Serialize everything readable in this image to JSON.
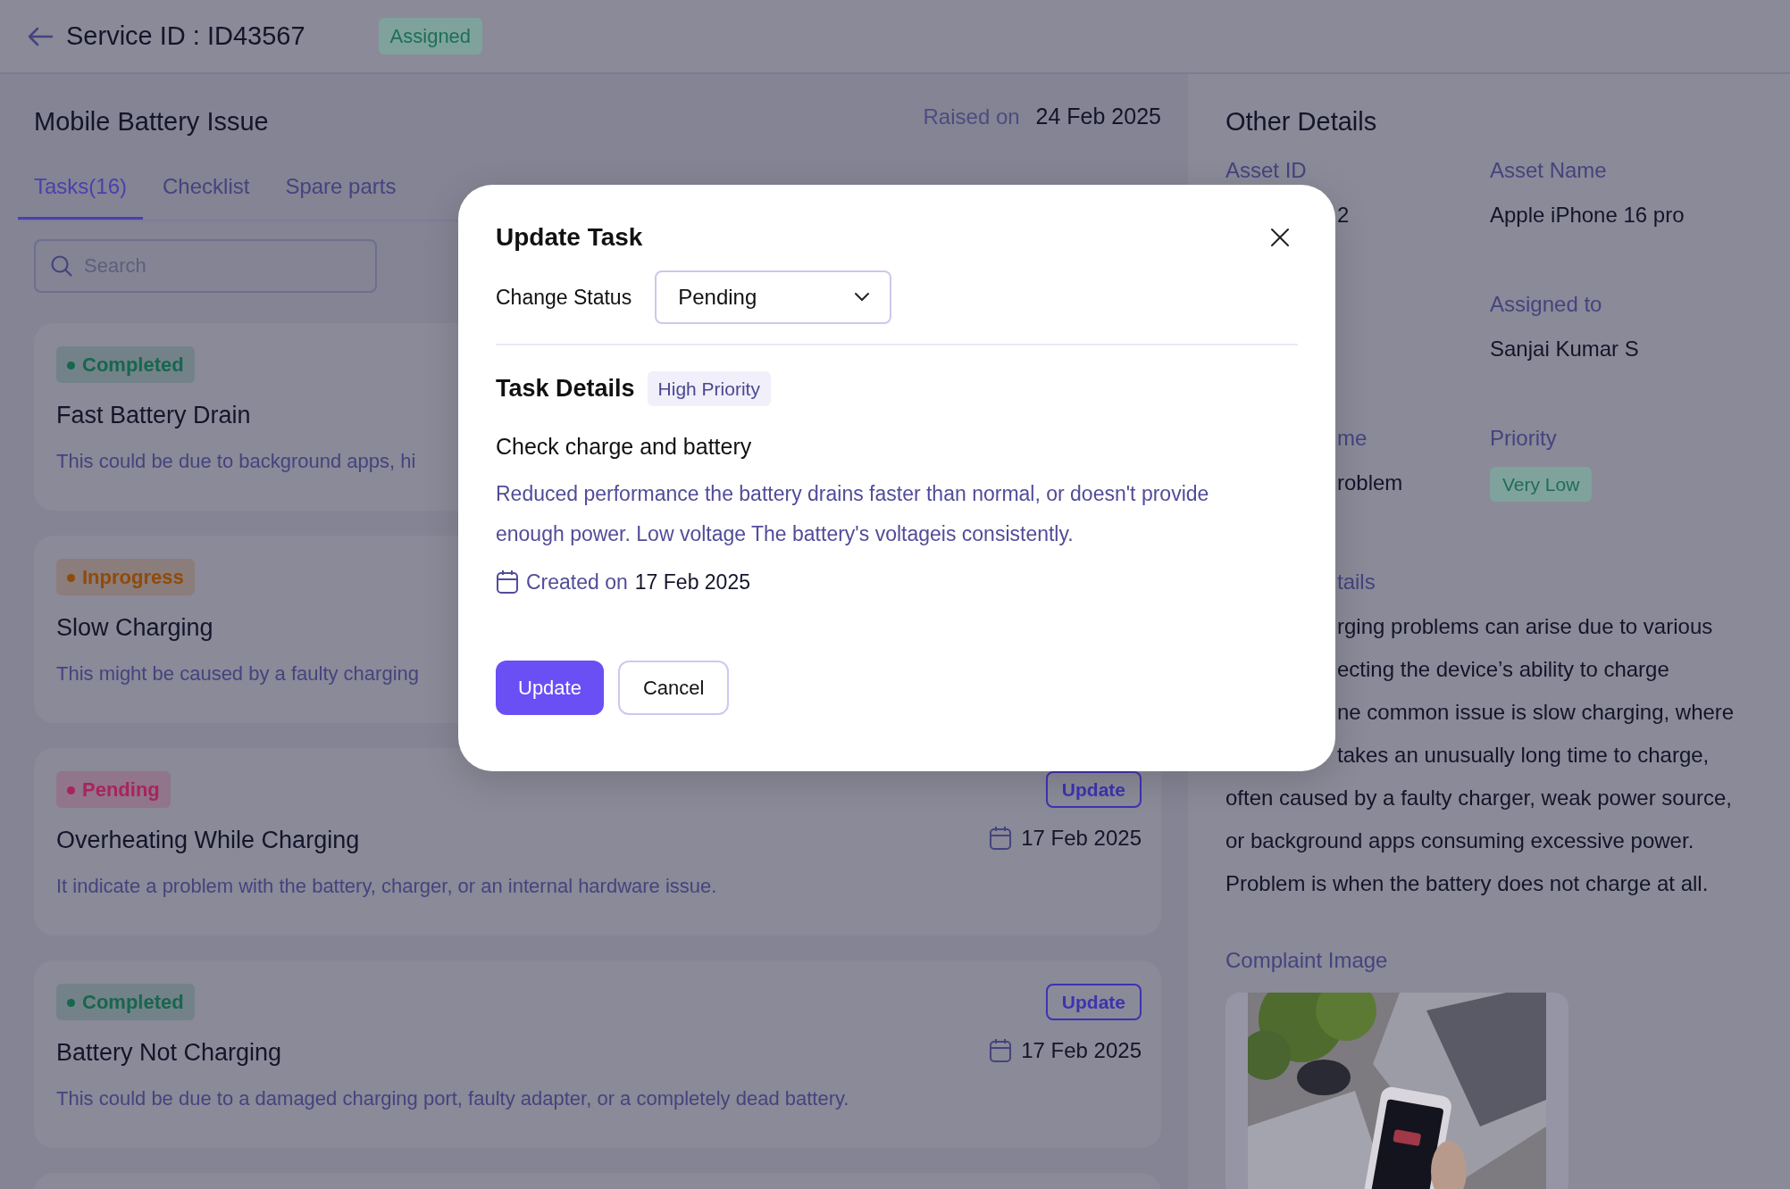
{
  "header": {
    "title": "Service ID : ID43567",
    "status": "Assigned"
  },
  "issue": {
    "title": "Mobile Battery Issue",
    "raised_label": "Raised on",
    "raised_date": "24 Feb 2025"
  },
  "tabs": [
    {
      "label": "Tasks(16)",
      "selected": true
    },
    {
      "label": "Checklist",
      "selected": false
    },
    {
      "label": "Spare parts",
      "selected": false
    }
  ],
  "search": {
    "placeholder": "Search"
  },
  "tasks": [
    {
      "status": "Completed",
      "color": "#17664e",
      "title": "Fast Battery Drain",
      "description": "This could be due to background apps, hi"
    },
    {
      "status": "Inprogress",
      "color": "#8f4a0c",
      "title": "Slow Charging",
      "description": "This might be caused by a faulty charging"
    },
    {
      "status": "Pending",
      "color": "#a8245c",
      "title": "Overheating While Charging",
      "description": "It indicate a problem with the battery, charger, or an internal hardware issue.",
      "action": "Update",
      "date": "17 Feb 2025"
    },
    {
      "status": "Completed",
      "color": "#17664e",
      "title": "Battery Not Charging",
      "description": "This could be due to a damaged charging port, faulty adapter, or a completely dead battery.",
      "action": "Update",
      "date": "17 Feb 2025"
    }
  ],
  "other_details": {
    "title": "Other Details",
    "rows": [
      {
        "left": {
          "label": {
            "text": "Asset ID"
          },
          "value": {
            "text": "2",
            "covered": true
          }
        },
        "right": {
          "label": {
            "text": "Asset Name"
          },
          "value": {
            "text": "Apple iPhone 16 pro",
            "kind": "text"
          }
        }
      },
      {
        "right": {
          "label": {
            "text": "Assigned to"
          },
          "value": {
            "text": "Sanjai Kumar S",
            "kind": "text"
          }
        }
      },
      {
        "left": {
          "label": {
            "text": "me",
            "covered": true
          },
          "value": {
            "text": "roblem",
            "covered": true
          }
        },
        "right": {
          "label": {
            "text": "Priority"
          },
          "value": {
            "text": "Very Low",
            "kind": "badge"
          }
        }
      }
    ],
    "complaint_details": {
      "label": {
        "text": "tails",
        "covered": true
      },
      "lines": [
        {
          "text": "rging problems can arise due to various",
          "covered": true
        },
        {
          "text": "ecting the device’s ability to charge",
          "covered": true
        },
        {
          "text": "ne common issue is slow charging, where",
          "covered": true
        },
        {
          "text": "takes an unusually long time to charge,",
          "covered": true
        },
        {
          "text": "often caused by a faulty charger, weak power source,",
          "covered": false
        },
        {
          "text": "or background apps consuming excessive power.",
          "covered": false
        },
        {
          "text": "Problem is when the battery does not charge at all.",
          "covered": false
        }
      ]
    },
    "complaint_image": {
      "label": "Complaint Image",
      "kind": "picture"
    }
  },
  "modal": {
    "title": "Update Task",
    "status_label": "Change Status",
    "status_value": "Pending",
    "section_title": "Task Details",
    "priority": "High Priority",
    "task_title": "Check charge and battery",
    "description": "Reduced performance the battery drains faster than normal, or doesn't provide enough power. Low voltage The battery's voltageis consistently.",
    "created_label": "Created on",
    "created_date": "17 Feb 2025",
    "buttons": [
      {
        "label": "Update",
        "kind": "primary"
      },
      {
        "label": "Cancel",
        "kind": "secondary"
      }
    ]
  }
}
